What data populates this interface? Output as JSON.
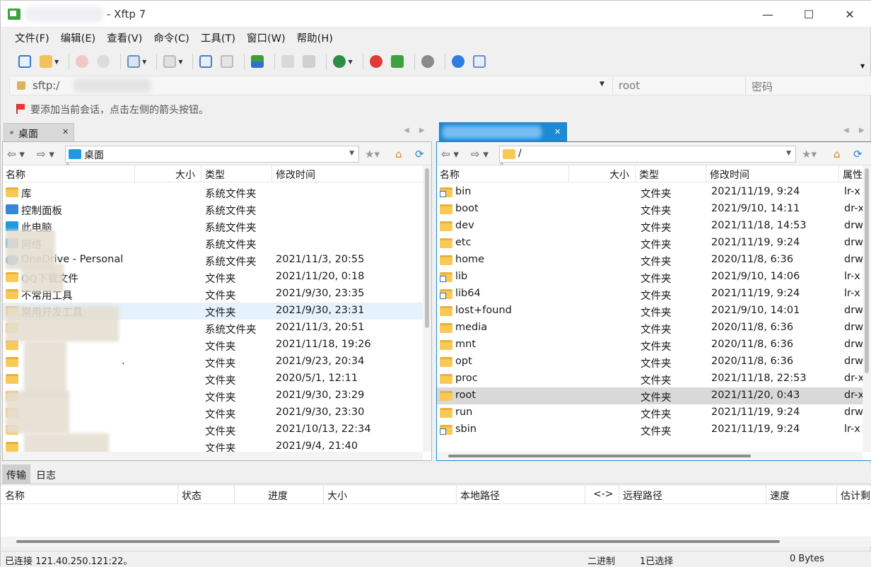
{
  "window": {
    "title": "- Xftp 7",
    "minimize": "—",
    "maximize": "☐",
    "close": "✕"
  },
  "menu": [
    "文件(F)",
    "编辑(E)",
    "查看(V)",
    "命令(C)",
    "工具(T)",
    "窗口(W)",
    "帮助(H)"
  ],
  "address": {
    "url": "sftp:/",
    "username_placeholder": "root",
    "password_placeholder": "密码"
  },
  "hint": "要添加当前会话，点击左侧的箭头按钮。",
  "local_tab": {
    "label": "桌面",
    "close": "✕"
  },
  "remote_tab": {
    "close": "✕"
  },
  "local": {
    "path": "桌面",
    "columns": {
      "name": "名称",
      "size": "大小",
      "type": "类型",
      "modified": "修改时间"
    },
    "rows": [
      {
        "name": "库",
        "type": "系统文件夹",
        "modified": ""
      },
      {
        "name": "控制面板",
        "type": "系统文件夹",
        "modified": ""
      },
      {
        "name": "此电脑",
        "type": "系统文件夹",
        "modified": ""
      },
      {
        "name": "网络",
        "type": "系统文件夹",
        "modified": ""
      },
      {
        "name": "OneDrive - Personal",
        "type": "系统文件夹",
        "modified": "2021/11/3, 20:55"
      },
      {
        "name": "QQ下载文件",
        "type": "文件夹",
        "modified": "2021/11/20, 0:18"
      },
      {
        "name": "不常用工具",
        "type": "文件夹",
        "modified": "2021/9/30, 23:35"
      },
      {
        "name": "常用开发工具",
        "type": "文件夹",
        "modified": "2021/9/30, 23:31"
      },
      {
        "name": "",
        "type": "系统文件夹",
        "modified": "2021/11/3, 20:51"
      },
      {
        "name": "",
        "type": "文件夹",
        "modified": "2021/11/18, 19:26"
      },
      {
        "name": ".",
        "type": "文件夹",
        "modified": "2021/9/23, 20:34"
      },
      {
        "name": "",
        "type": "文件夹",
        "modified": "2020/5/1, 12:11"
      },
      {
        "name": "",
        "type": "文件夹",
        "modified": "2021/9/30, 23:29"
      },
      {
        "name": "",
        "type": "文件夹",
        "modified": "2021/9/30, 23:30"
      },
      {
        "name": "",
        "type": "文件夹",
        "modified": "2021/10/13, 22:34"
      },
      {
        "name": "",
        "type": "文件夹",
        "modified": "2021/9/4, 21:40"
      }
    ]
  },
  "remote": {
    "path": "/",
    "columns": {
      "name": "名称",
      "size": "大小",
      "type": "类型",
      "modified": "修改时间",
      "attr": "属性"
    },
    "rows": [
      {
        "name": "bin",
        "type": "文件夹",
        "modified": "2021/11/19, 9:24",
        "attr": "lr-x",
        "link": true
      },
      {
        "name": "boot",
        "type": "文件夹",
        "modified": "2021/9/10, 14:11",
        "attr": "dr-x",
        "link": false
      },
      {
        "name": "dev",
        "type": "文件夹",
        "modified": "2021/11/18, 14:53",
        "attr": "drw",
        "link": false
      },
      {
        "name": "etc",
        "type": "文件夹",
        "modified": "2021/11/19, 9:24",
        "attr": "drw",
        "link": false
      },
      {
        "name": "home",
        "type": "文件夹",
        "modified": "2020/11/8, 6:36",
        "attr": "drw",
        "link": false
      },
      {
        "name": "lib",
        "type": "文件夹",
        "modified": "2021/9/10, 14:06",
        "attr": "lr-x",
        "link": true
      },
      {
        "name": "lib64",
        "type": "文件夹",
        "modified": "2021/11/19, 9:24",
        "attr": "lr-x",
        "link": true
      },
      {
        "name": "lost+found",
        "type": "文件夹",
        "modified": "2021/9/10, 14:01",
        "attr": "drw",
        "link": false
      },
      {
        "name": "media",
        "type": "文件夹",
        "modified": "2020/11/8, 6:36",
        "attr": "drw",
        "link": false
      },
      {
        "name": "mnt",
        "type": "文件夹",
        "modified": "2020/11/8, 6:36",
        "attr": "drw",
        "link": false
      },
      {
        "name": "opt",
        "type": "文件夹",
        "modified": "2020/11/8, 6:36",
        "attr": "drw",
        "link": false
      },
      {
        "name": "proc",
        "type": "文件夹",
        "modified": "2021/11/18, 22:53",
        "attr": "dr-x",
        "link": false
      },
      {
        "name": "root",
        "type": "文件夹",
        "modified": "2021/11/20, 0:43",
        "attr": "dr-x",
        "link": false
      },
      {
        "name": "run",
        "type": "文件夹",
        "modified": "2021/11/19, 9:24",
        "attr": "drw",
        "link": false
      },
      {
        "name": "sbin",
        "type": "文件夹",
        "modified": "2021/11/19, 9:24",
        "attr": "lr-x",
        "link": true
      }
    ]
  },
  "bottom_tabs": [
    "传输",
    "日志"
  ],
  "transfer_columns": [
    "名称",
    "状态",
    "进度",
    "大小",
    "本地路径",
    "<->",
    "远程路径",
    "速度",
    "估计剩"
  ],
  "status": {
    "connection": "已连接 121.40.250.121:22。",
    "mode": "二进制",
    "selection": "1已选择",
    "size": "0 Bytes"
  }
}
